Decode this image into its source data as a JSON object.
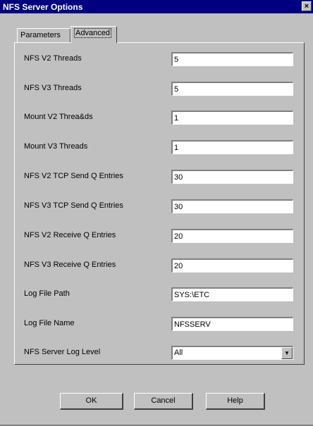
{
  "window": {
    "title": "NFS Server Options",
    "close_glyph": "×"
  },
  "tabs": [
    {
      "label": "Parameters",
      "active": false
    },
    {
      "label": "Advanced",
      "active": true
    }
  ],
  "fields": [
    {
      "label": "NFS V2 Threads",
      "value": "5"
    },
    {
      "label": "NFS V3 Threads",
      "value": "5"
    },
    {
      "label": "Mount V2 Threa&ds",
      "value": "1"
    },
    {
      "label": "Mount V3 Threads",
      "value": "1"
    },
    {
      "label": "NFS V2 TCP Send Q Entries",
      "value": "30"
    },
    {
      "label": "NFS V3 TCP Send Q Entries",
      "value": "30"
    },
    {
      "label": "NFS V2 Receive Q Entries",
      "value": "20"
    },
    {
      "label": "NFS V3 Receive Q Entries",
      "value": "20"
    },
    {
      "label": "Log File Path",
      "value": "SYS:\\ETC"
    },
    {
      "label": "Log File Name",
      "value": "NFSSERV"
    }
  ],
  "log_level": {
    "label": "NFS Server Log Level",
    "selected": "All",
    "arrow_icon": "chevron-down-icon"
  },
  "buttons": {
    "ok": "OK",
    "cancel": "Cancel",
    "help": "Help"
  }
}
